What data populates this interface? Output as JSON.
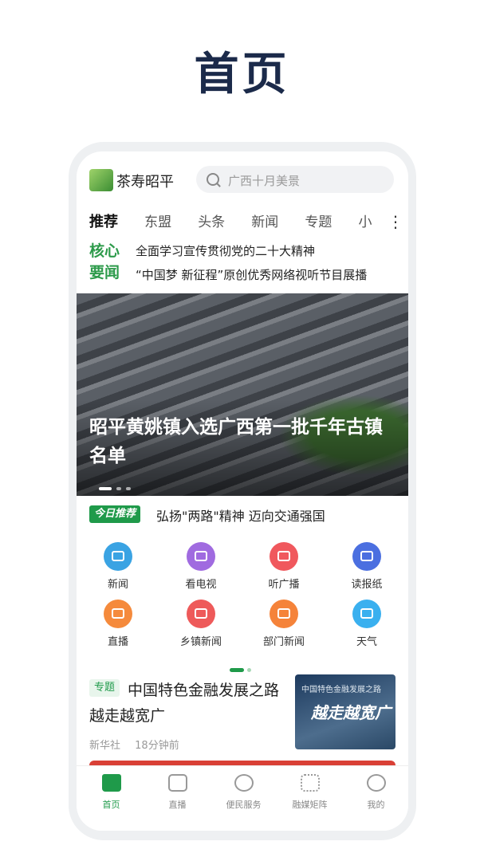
{
  "page_title": "首页",
  "header": {
    "app_name": "茶寿昭平",
    "search_placeholder": "广西十月美景"
  },
  "tabs": [
    "推荐",
    "东盟",
    "头条",
    "新闻",
    "专题",
    "小"
  ],
  "core_news": {
    "label": "核心要闻",
    "items": [
      "全面学习宣传贯彻党的二十大精神",
      "“中国梦 新征程”原创优秀网络视听节目展播"
    ]
  },
  "banner": {
    "title": "昭平黄姚镇入选广西第一批千年古镇名单"
  },
  "today": {
    "badge": "今日推荐",
    "text": "弘扬\"两路\"精神 迈向交通强国"
  },
  "grid": [
    {
      "label": "新闻",
      "icon": "news-icon",
      "color": "#3aa3e3"
    },
    {
      "label": "看电视",
      "icon": "tv-icon",
      "color": "#a06be0"
    },
    {
      "label": "听广播",
      "icon": "radio-icon",
      "color": "#f0585d"
    },
    {
      "label": "读报纸",
      "icon": "newspaper-icon",
      "color": "#4b6fe0"
    },
    {
      "label": "直播",
      "icon": "live-icon",
      "color": "#f58a3c"
    },
    {
      "label": "乡镇新闻",
      "icon": "town-news-icon",
      "color": "#ee5a5a"
    },
    {
      "label": "部门新闻",
      "icon": "department-news-icon",
      "color": "#f5833a"
    },
    {
      "label": "天气",
      "icon": "weather-icon",
      "color": "#3ab0ef"
    }
  ],
  "article": {
    "tag": "专题",
    "title": "中国特色金融发展之路越走越宽广",
    "source": "新华社",
    "time": "18分钟前",
    "thumb_caption": "中国特色金融发展之路",
    "thumb_title": "越走越宽广"
  },
  "bottom_nav": [
    {
      "label": "首页",
      "icon": "home-icon"
    },
    {
      "label": "直播",
      "icon": "live-play-icon"
    },
    {
      "label": "便民服务",
      "icon": "heart-icon"
    },
    {
      "label": "融媒矩阵",
      "icon": "matrix-icon"
    },
    {
      "label": "我的",
      "icon": "profile-icon"
    }
  ],
  "colors": {
    "brand": "#1f9a4a",
    "title": "#1b2a4a"
  }
}
